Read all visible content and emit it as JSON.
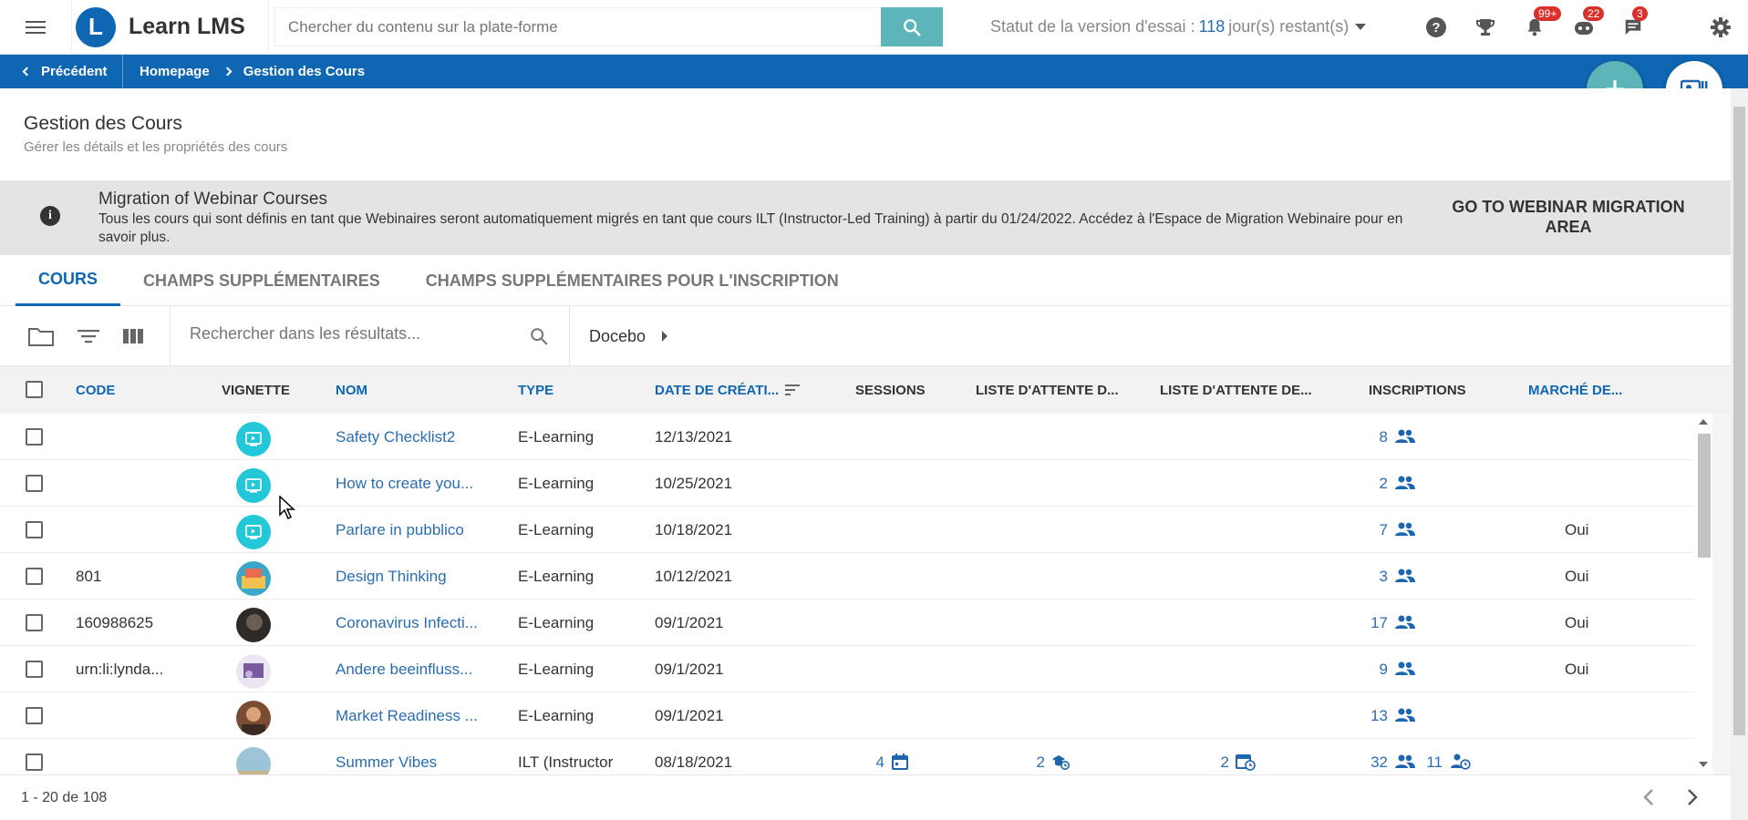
{
  "app": {
    "logo_letter": "L",
    "name": "Learn LMS",
    "search_placeholder": "Chercher du contenu sur la plate-forme",
    "trial_prefix": "Statut de la version d'essai :",
    "trial_days": "118",
    "trial_suffix": "jour(s) restant(s)",
    "badges": {
      "notifications": "99+",
      "messages": "22",
      "chat": "3"
    }
  },
  "breadcrumb": {
    "back": "Précédent",
    "items": [
      "Homepage",
      "Gestion des Cours"
    ]
  },
  "page": {
    "title": "Gestion des Cours",
    "subtitle": "Gérer les détails et les propriétés des cours"
  },
  "banner": {
    "title": "Migration of Webinar Courses",
    "text": "Tous les cours qui sont définis en tant que Webinaires seront automatiquement migrés en tant que cours ILT (Instructor-Led Training) à partir du 01/24/2022. Accédez à l'Espace de Migration Webinaire pour en savoir plus.",
    "link": "GO TO WEBINAR MIGRATION AREA"
  },
  "tabs": [
    "COURS",
    "CHAMPS SUPPLÉMENTAIRES",
    "CHAMPS SUPPLÉMENTAIRES POUR L'INSCRIPTION"
  ],
  "toolbar": {
    "search_placeholder": "Rechercher dans les résultats...",
    "folder": "Docebo"
  },
  "table": {
    "columns": [
      "CODE",
      "VIGNETTE",
      "NOM",
      "TYPE",
      "DATE DE CRÉATI...",
      "SESSIONS",
      "LISTE D'ATTENTE D...",
      "LISTE D'ATTENTE DE...",
      "INSCRIPTIONS",
      "MARCHÉ DE..."
    ],
    "rows": [
      {
        "code": "",
        "thumb": "video",
        "name": "Safety Checklist2",
        "type": "E-Learning",
        "date": "12/13/2021",
        "sessions": "",
        "wait1": "",
        "wait2": "",
        "enroll": "8",
        "enroll_pending": "",
        "market": ""
      },
      {
        "code": "",
        "thumb": "video",
        "name": "How to create you...",
        "type": "E-Learning",
        "date": "10/25/2021",
        "sessions": "",
        "wait1": "",
        "wait2": "",
        "enroll": "2",
        "enroll_pending": "",
        "market": ""
      },
      {
        "code": "",
        "thumb": "video",
        "name": "Parlare in pubblico",
        "type": "E-Learning",
        "date": "10/18/2021",
        "sessions": "",
        "wait1": "",
        "wait2": "",
        "enroll": "7",
        "enroll_pending": "",
        "market": "Oui"
      },
      {
        "code": "801",
        "thumb": "design",
        "name": "Design Thinking",
        "type": "E-Learning",
        "date": "10/12/2021",
        "sessions": "",
        "wait1": "",
        "wait2": "",
        "enroll": "3",
        "enroll_pending": "",
        "market": "Oui"
      },
      {
        "code": "160988625",
        "thumb": "dark",
        "name": "Coronavirus Infecti...",
        "type": "E-Learning",
        "date": "09/1/2021",
        "sessions": "",
        "wait1": "",
        "wait2": "",
        "enroll": "17",
        "enroll_pending": "",
        "market": "Oui"
      },
      {
        "code": "urn:li:lynda...",
        "thumb": "purple",
        "name": "Andere beeinfluss...",
        "type": "E-Learning",
        "date": "09/1/2021",
        "sessions": "",
        "wait1": "",
        "wait2": "",
        "enroll": "9",
        "enroll_pending": "",
        "market": "Oui"
      },
      {
        "code": "",
        "thumb": "brown",
        "name": "Market Readiness ...",
        "type": "E-Learning",
        "date": "09/1/2021",
        "sessions": "",
        "wait1": "",
        "wait2": "",
        "enroll": "13",
        "enroll_pending": "",
        "market": ""
      },
      {
        "code": "",
        "thumb": "sky",
        "name": "Summer Vibes",
        "type": "ILT (Instructor",
        "date": "08/18/2021",
        "sessions": "4",
        "wait1": "2",
        "wait2": "2",
        "enroll": "32",
        "enroll_pending": "11",
        "market": ""
      }
    ]
  },
  "footer": {
    "pagination": "1 - 20 de 108"
  },
  "colors": {
    "primary": "#0f66b3",
    "teal": "#5db4b9",
    "link": "#2a6db0",
    "badge": "#d9302c"
  }
}
